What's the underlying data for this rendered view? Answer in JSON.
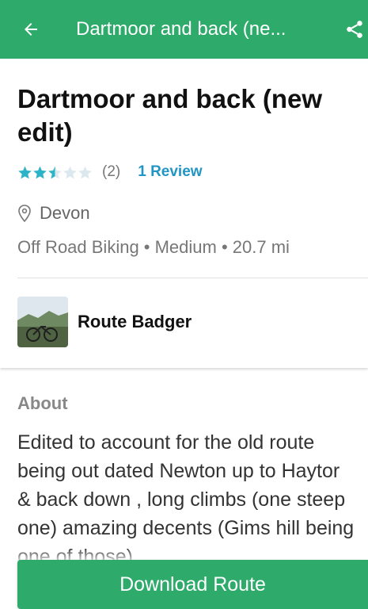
{
  "appbar": {
    "title": "Dartmoor and back (ne...",
    "back_icon": "arrow-left-icon",
    "share_icon": "share-icon",
    "background_color": "#2eaa6b"
  },
  "route": {
    "title": "Dartmoor and back (new edit)",
    "rating": 2.5,
    "rating_max": 5,
    "rating_count": "(2)",
    "reviews_link": "1 Review",
    "location": "Devon",
    "stats": "Off Road Biking • Medium • 20.7 mi"
  },
  "author": {
    "name": "Route Badger"
  },
  "about": {
    "label": "About",
    "text": "Edited to account for the old route being out dated Newton up to Haytor & back down , long climbs (one steep one) amazing decents (Gims hill being one of those)"
  },
  "actions": {
    "download_label": "Download Route"
  },
  "colors": {
    "accent": "#2eaa6b",
    "star": "#2bb3c8",
    "link": "#2196c4"
  }
}
